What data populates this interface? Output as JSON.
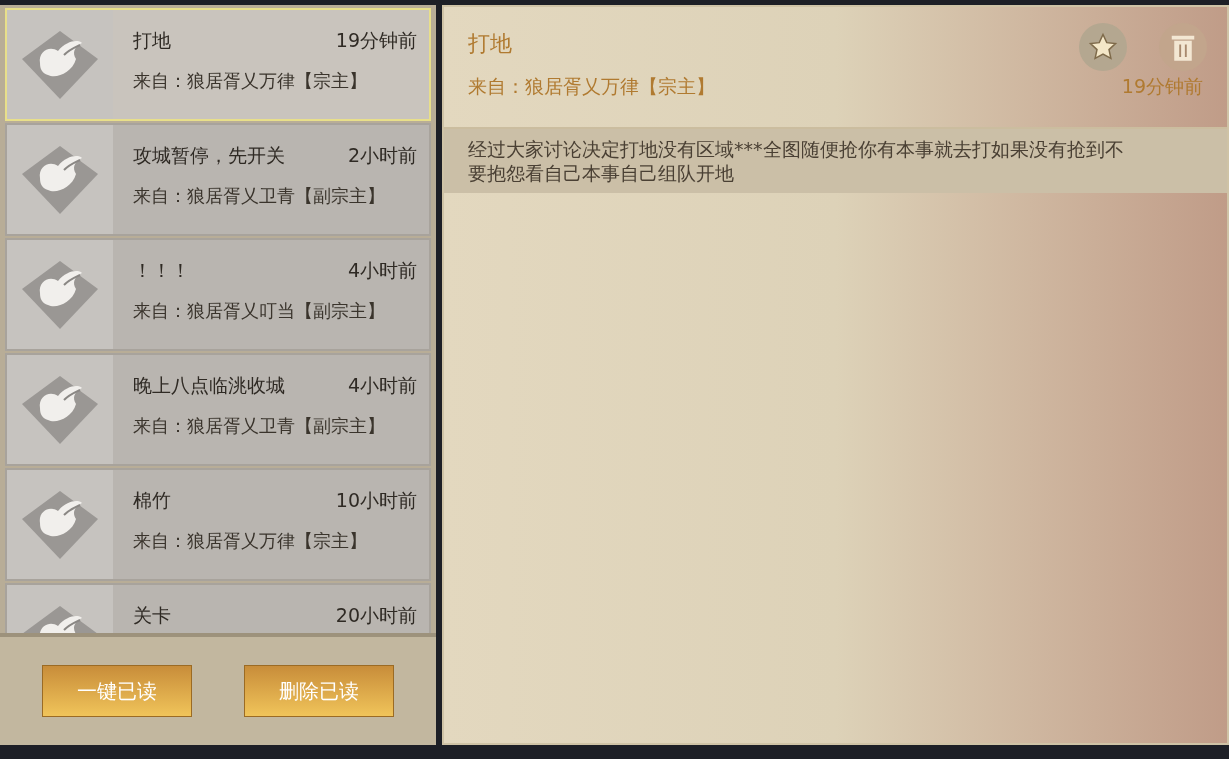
{
  "mails": [
    {
      "title": "打地",
      "time": "19分钟前",
      "from": "来自：狼居胥乂万律【宗主】",
      "selected": true
    },
    {
      "title": "攻城暂停，先开关",
      "time": "2小时前",
      "from": "来自：狼居胥乂卫青【副宗主】",
      "selected": false
    },
    {
      "title": "！！！",
      "time": "4小时前",
      "from": "来自：狼居胥乂叮当【副宗主】",
      "selected": false
    },
    {
      "title": "晚上八点临洮收城",
      "time": "4小时前",
      "from": "来自：狼居胥乂卫青【副宗主】",
      "selected": false
    },
    {
      "title": "棉竹",
      "time": "10小时前",
      "from": "来自：狼居胥乂万律【宗主】",
      "selected": false
    },
    {
      "title": "关卡",
      "time": "20小时前",
      "selected": false
    }
  ],
  "buttons": [
    "一键已读",
    "删除已读"
  ],
  "detail": {
    "title": "打地",
    "from": "来自：狼居胥乂万律【宗主】",
    "time": "19分钟前",
    "body": "经过大家讨论决定打地没有区域***全图随便抢你有本事就去打如果没有抢到不要抱怨看自己本事自己组队开地"
  }
}
